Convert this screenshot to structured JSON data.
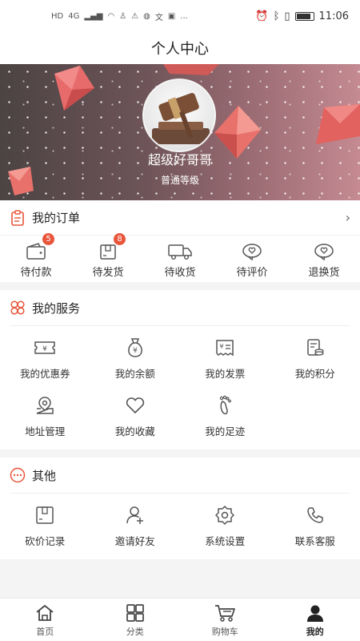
{
  "status_bar": {
    "left_icons": [
      "HD",
      "4G",
      "signal-icon",
      "wifi-icon",
      "qq-icon",
      "warning-icon",
      "app-icon",
      "translate-icon",
      "app-icon",
      "..."
    ],
    "time": "11:06"
  },
  "header": {
    "title": "个人中心"
  },
  "profile": {
    "username": "超级好哥哥",
    "level": "普通等级"
  },
  "orders": {
    "title": "我的订单",
    "items": [
      {
        "label": "待付款",
        "icon": "wallet-icon",
        "badge": "5"
      },
      {
        "label": "待发货",
        "icon": "box-icon",
        "badge": "8"
      },
      {
        "label": "待收货",
        "icon": "truck-icon",
        "badge": ""
      },
      {
        "label": "待评价",
        "icon": "comment-heart-icon",
        "badge": ""
      },
      {
        "label": "退换货",
        "icon": "return-heart-icon",
        "badge": ""
      }
    ]
  },
  "services": {
    "title": "我的服务",
    "items": [
      {
        "label": "我的优惠券",
        "icon": "coupon-icon"
      },
      {
        "label": "我的余额",
        "icon": "money-bag-icon"
      },
      {
        "label": "我的发票",
        "icon": "invoice-icon"
      },
      {
        "label": "我的积分",
        "icon": "points-icon"
      },
      {
        "label": "地址管理",
        "icon": "location-icon"
      },
      {
        "label": "我的收藏",
        "icon": "heart-icon"
      },
      {
        "label": "我的足迹",
        "icon": "footprint-icon"
      }
    ]
  },
  "others": {
    "title": "其他",
    "items": [
      {
        "label": "砍价记录",
        "icon": "bargain-icon"
      },
      {
        "label": "邀请好友",
        "icon": "invite-user-icon"
      },
      {
        "label": "系统设置",
        "icon": "settings-icon"
      },
      {
        "label": "联系客服",
        "icon": "phone-icon"
      }
    ]
  },
  "tabbar": {
    "items": [
      {
        "label": "首页",
        "icon": "home-icon"
      },
      {
        "label": "分类",
        "icon": "category-icon"
      },
      {
        "label": "购物车",
        "icon": "cart-icon"
      },
      {
        "label": "我的",
        "icon": "user-icon"
      }
    ],
    "active": "我的"
  },
  "colors": {
    "accent": "#e8553b",
    "badge": "#e8553b",
    "banner_start": "#4c4343",
    "banner_end": "#c58a92"
  }
}
